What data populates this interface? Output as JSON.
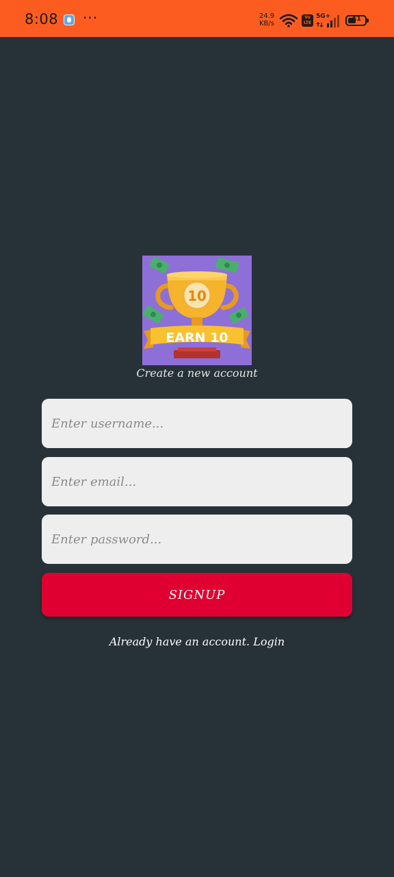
{
  "status_bar": {
    "time": "8:08",
    "dots": "···",
    "speed_value": "24.9",
    "speed_unit": "KB/s",
    "volte_label": "Vo LTE",
    "network_label": "5G+",
    "battery_level": "41",
    "background_color": "#fd5c21"
  },
  "logo": {
    "badge_number": "10",
    "banner_text": "EARN 10"
  },
  "form": {
    "subtitle": "Create a new account",
    "username_placeholder": "Enter username...",
    "email_placeholder": "Enter email...",
    "password_placeholder": "Enter password...",
    "signup_label": "SIGNUP",
    "login_prompt": "Already have an account. Login"
  },
  "colors": {
    "background": "#263238",
    "field_background": "#eeeeee",
    "signup_button": "#df0031"
  }
}
